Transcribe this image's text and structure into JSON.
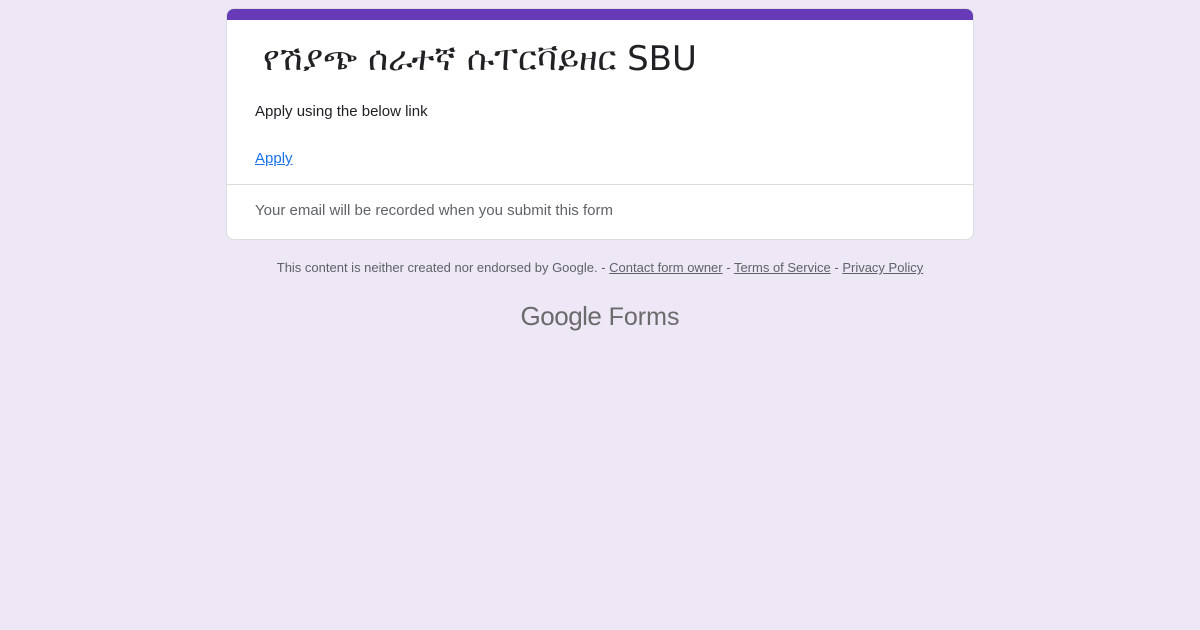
{
  "form": {
    "title": "የሽያጭ ሰራተኛ ሱፐርቫይዘር SBU",
    "description": "Apply using the below link",
    "link_label": "Apply",
    "email_notice": "Your email will be recorded when you submit this form"
  },
  "footer": {
    "disclaimer": "This content is neither created nor endorsed by Google. - ",
    "separator_1": " - ",
    "separator_2": " - ",
    "contact_owner": "Contact form owner",
    "terms": "Terms of Service",
    "privacy": "Privacy Policy"
  },
  "brand": {
    "google": "Google",
    "product": "Forms"
  },
  "colors": {
    "accent": "#673ab7",
    "background": "#ede7f6",
    "link": "#1a73e8"
  }
}
